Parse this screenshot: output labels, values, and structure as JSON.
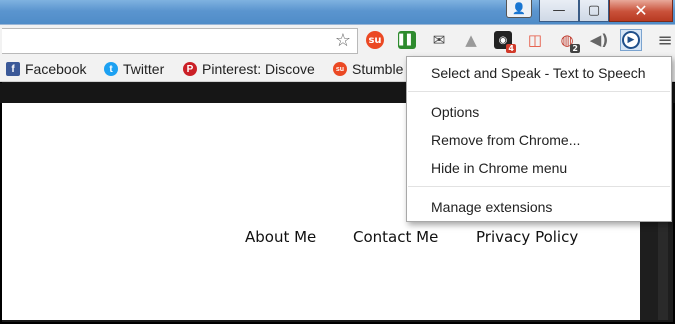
{
  "window": {
    "minimize_glyph": "—",
    "maximize_glyph": "▢",
    "close_glyph": "✕",
    "profile_glyph": "👤"
  },
  "toolbar": {
    "star_glyph": "☆",
    "extensions": [
      {
        "name": "stumbleupon-icon",
        "glyph": "su",
        "color": "#eb4924",
        "badge": ""
      },
      {
        "name": "pause-play-icon",
        "glyph": "▌▌",
        "color": "#2e8b2e",
        "badge": ""
      },
      {
        "name": "mail-icon",
        "glyph": "✉",
        "color": "#444444",
        "badge": ""
      },
      {
        "name": "drive-icon",
        "glyph": "▲",
        "color": "#9a9a9a",
        "badge": ""
      },
      {
        "name": "camera-icon",
        "glyph": "◉",
        "color": "#222222",
        "badge": "4"
      },
      {
        "name": "screen-capture-icon",
        "glyph": "◫",
        "color": "#e5533d",
        "badge": ""
      },
      {
        "name": "shield-icon",
        "glyph": "◍",
        "color": "#c0392b",
        "badge": "2"
      },
      {
        "name": "speaker-icon",
        "glyph": "◀)",
        "color": "#666666",
        "badge": ""
      },
      {
        "name": "select-and-speak-icon",
        "glyph": "▶",
        "color": "#1f4f8a",
        "badge": ""
      }
    ],
    "menu_glyph": "≡"
  },
  "bookmarks": [
    {
      "label": "Facebook",
      "icon": "facebook-icon",
      "glyph": "f",
      "color": "#3b5998"
    },
    {
      "label": "Twitter",
      "icon": "twitter-icon",
      "glyph": "t",
      "color": "#1da1f2"
    },
    {
      "label": "Pinterest: Discove",
      "icon": "pinterest-icon",
      "glyph": "P",
      "color": "#cb2027"
    },
    {
      "label": "Stumble",
      "icon": "stumbleupon-icon",
      "glyph": "su",
      "color": "#eb4924"
    }
  ],
  "page": {
    "nav": [
      "About Me",
      "Contact Me",
      "Privacy Policy"
    ]
  },
  "menu": {
    "title": "Select and Speak - Text to Speech",
    "options": "Options",
    "remove": "Remove from Chrome...",
    "hide": "Hide in Chrome menu",
    "manage": "Manage extensions"
  }
}
